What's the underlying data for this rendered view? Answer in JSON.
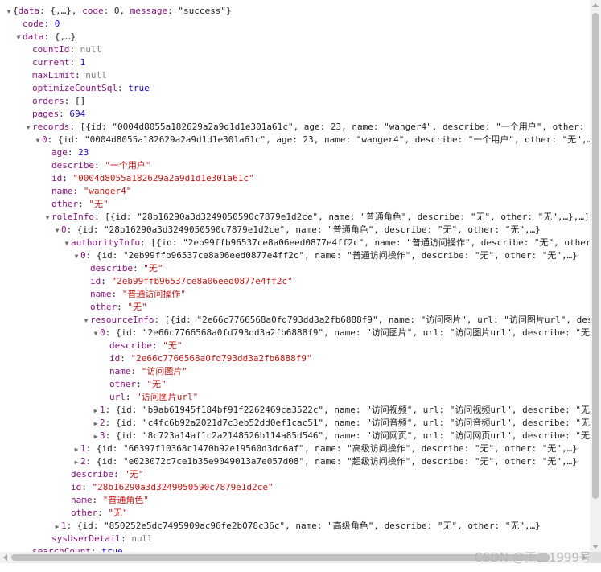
{
  "lines": [
    {
      "indent": 0,
      "arrow": "down",
      "segs": [
        [
          "plain",
          "{"
        ],
        [
          "key",
          "data"
        ],
        [
          "plain",
          ": {,…}, "
        ],
        [
          "key",
          "code"
        ],
        [
          "plain",
          ": 0, "
        ],
        [
          "key",
          "message"
        ],
        [
          "plain",
          ": \"success\"}"
        ]
      ]
    },
    {
      "indent": 1,
      "arrow": "",
      "segs": [
        [
          "key",
          "code"
        ],
        [
          "plain",
          ": "
        ],
        [
          "num",
          "0"
        ]
      ]
    },
    {
      "indent": 1,
      "arrow": "down",
      "segs": [
        [
          "key",
          "data"
        ],
        [
          "plain",
          ": {,…}"
        ]
      ]
    },
    {
      "indent": 2,
      "arrow": "",
      "segs": [
        [
          "key",
          "countId"
        ],
        [
          "plain",
          ": "
        ],
        [
          "nul",
          "null"
        ]
      ]
    },
    {
      "indent": 2,
      "arrow": "",
      "segs": [
        [
          "key",
          "current"
        ],
        [
          "plain",
          ": "
        ],
        [
          "num",
          "1"
        ]
      ]
    },
    {
      "indent": 2,
      "arrow": "",
      "segs": [
        [
          "key",
          "maxLimit"
        ],
        [
          "plain",
          ": "
        ],
        [
          "nul",
          "null"
        ]
      ]
    },
    {
      "indent": 2,
      "arrow": "",
      "segs": [
        [
          "key",
          "optimizeCountSql"
        ],
        [
          "plain",
          ": "
        ],
        [
          "kw",
          "true"
        ]
      ]
    },
    {
      "indent": 2,
      "arrow": "",
      "segs": [
        [
          "key",
          "orders"
        ],
        [
          "plain",
          ": []"
        ]
      ]
    },
    {
      "indent": 2,
      "arrow": "",
      "segs": [
        [
          "key",
          "pages"
        ],
        [
          "plain",
          ": "
        ],
        [
          "num",
          "694"
        ]
      ]
    },
    {
      "indent": 2,
      "arrow": "down",
      "segs": [
        [
          "key",
          "records"
        ],
        [
          "plain",
          ": [{id: \"0004d8055a182629a2a9d1d1e301a61c\", age: 23, name: \"wanger4\", describe: \"一个用户\", other: \"无\",…},…]"
        ]
      ]
    },
    {
      "indent": 3,
      "arrow": "down",
      "segs": [
        [
          "idx",
          "0"
        ],
        [
          "plain",
          ": {id: \"0004d8055a182629a2a9d1d1e301a61c\", age: 23, name: \"wanger4\", describe: \"一个用户\", other: \"无\",…}"
        ]
      ]
    },
    {
      "indent": 4,
      "arrow": "",
      "segs": [
        [
          "key",
          "age"
        ],
        [
          "plain",
          ": "
        ],
        [
          "num",
          "23"
        ]
      ]
    },
    {
      "indent": 4,
      "arrow": "",
      "segs": [
        [
          "key",
          "describe"
        ],
        [
          "plain",
          ": "
        ],
        [
          "str",
          "\"一个用户\""
        ]
      ]
    },
    {
      "indent": 4,
      "arrow": "",
      "segs": [
        [
          "key",
          "id"
        ],
        [
          "plain",
          ": "
        ],
        [
          "str",
          "\"0004d8055a182629a2a9d1d1e301a61c\""
        ]
      ]
    },
    {
      "indent": 4,
      "arrow": "",
      "segs": [
        [
          "key",
          "name"
        ],
        [
          "plain",
          ": "
        ],
        [
          "str",
          "\"wanger4\""
        ]
      ]
    },
    {
      "indent": 4,
      "arrow": "",
      "segs": [
        [
          "key",
          "other"
        ],
        [
          "plain",
          ": "
        ],
        [
          "str",
          "\"无\""
        ]
      ]
    },
    {
      "indent": 4,
      "arrow": "down",
      "segs": [
        [
          "key",
          "roleInfo"
        ],
        [
          "plain",
          ": [{id: \"28b16290a3d3249050590c7879e1d2ce\", name: \"普通角色\", describe: \"无\", other: \"无\",…},…]"
        ]
      ]
    },
    {
      "indent": 5,
      "arrow": "down",
      "segs": [
        [
          "idx",
          "0"
        ],
        [
          "plain",
          ": {id: \"28b16290a3d3249050590c7879e1d2ce\", name: \"普通角色\", describe: \"无\", other: \"无\",…}"
        ]
      ]
    },
    {
      "indent": 6,
      "arrow": "down",
      "segs": [
        [
          "key",
          "authorityInfo"
        ],
        [
          "plain",
          ": [{id: \"2eb99ffb96537ce8a06eed0877e4ff2c\", name: \"普通访问操作\", describe: \"无\", other: \"无\",…},…]"
        ]
      ]
    },
    {
      "indent": 7,
      "arrow": "down",
      "segs": [
        [
          "idx",
          "0"
        ],
        [
          "plain",
          ": {id: \"2eb99ffb96537ce8a06eed0877e4ff2c\", name: \"普通访问操作\", describe: \"无\", other: \"无\",…}"
        ]
      ]
    },
    {
      "indent": 8,
      "arrow": "",
      "segs": [
        [
          "key",
          "describe"
        ],
        [
          "plain",
          ": "
        ],
        [
          "str",
          "\"无\""
        ]
      ]
    },
    {
      "indent": 8,
      "arrow": "",
      "segs": [
        [
          "key",
          "id"
        ],
        [
          "plain",
          ": "
        ],
        [
          "str",
          "\"2eb99ffb96537ce8a06eed0877e4ff2c\""
        ]
      ]
    },
    {
      "indent": 8,
      "arrow": "",
      "segs": [
        [
          "key",
          "name"
        ],
        [
          "plain",
          ": "
        ],
        [
          "str",
          "\"普通访问操作\""
        ]
      ]
    },
    {
      "indent": 8,
      "arrow": "",
      "segs": [
        [
          "key",
          "other"
        ],
        [
          "plain",
          ": "
        ],
        [
          "str",
          "\"无\""
        ]
      ]
    },
    {
      "indent": 8,
      "arrow": "down",
      "segs": [
        [
          "key",
          "resourceInfo"
        ],
        [
          "plain",
          ": [{id: \"2e66c7766568a0fd793dd3a2fb6888f9\", name: \"访问图片\", url: \"访问图片url\", describe: \"无\",…},…]"
        ]
      ]
    },
    {
      "indent": 9,
      "arrow": "down",
      "segs": [
        [
          "idx",
          "0"
        ],
        [
          "plain",
          ": {id: \"2e66c7766568a0fd793dd3a2fb6888f9\", name: \"访问图片\", url: \"访问图片url\", describe: \"无\",…}"
        ]
      ]
    },
    {
      "indent": 10,
      "arrow": "",
      "segs": [
        [
          "key",
          "describe"
        ],
        [
          "plain",
          ": "
        ],
        [
          "str",
          "\"无\""
        ]
      ]
    },
    {
      "indent": 10,
      "arrow": "",
      "segs": [
        [
          "key",
          "id"
        ],
        [
          "plain",
          ": "
        ],
        [
          "str",
          "\"2e66c7766568a0fd793dd3a2fb6888f9\""
        ]
      ]
    },
    {
      "indent": 10,
      "arrow": "",
      "segs": [
        [
          "key",
          "name"
        ],
        [
          "plain",
          ": "
        ],
        [
          "str",
          "\"访问图片\""
        ]
      ]
    },
    {
      "indent": 10,
      "arrow": "",
      "segs": [
        [
          "key",
          "other"
        ],
        [
          "plain",
          ": "
        ],
        [
          "str",
          "\"无\""
        ]
      ]
    },
    {
      "indent": 10,
      "arrow": "",
      "segs": [
        [
          "key",
          "url"
        ],
        [
          "plain",
          ": "
        ],
        [
          "str",
          "\"访问图片url\""
        ]
      ]
    },
    {
      "indent": 9,
      "arrow": "right",
      "segs": [
        [
          "idx",
          "1"
        ],
        [
          "plain",
          ": {id: \"b9ab61945f184bf91f2262469ca3522c\", name: \"访问视频\", url: \"访问视频url\", describe: \"无\",…}"
        ]
      ]
    },
    {
      "indent": 9,
      "arrow": "right",
      "segs": [
        [
          "idx",
          "2"
        ],
        [
          "plain",
          ": {id: \"c4fc6b92a2021d7c3eb52dd0ef1cac51\", name: \"访问音频\", url: \"访问音频url\", describe: \"无\",…}"
        ]
      ]
    },
    {
      "indent": 9,
      "arrow": "right",
      "segs": [
        [
          "idx",
          "3"
        ],
        [
          "plain",
          ": {id: \"8c723a14af1c2a2148526b114a85d546\", name: \"访问网页\", url: \"访问网页url\", describe: \"无\",…}"
        ]
      ]
    },
    {
      "indent": 7,
      "arrow": "right",
      "segs": [
        [
          "idx",
          "1"
        ],
        [
          "plain",
          ": {id: \"66397f10368c1470b92e19560d3dc6af\", name: \"高级访问操作\", describe: \"无\", other: \"无\",…}"
        ]
      ]
    },
    {
      "indent": 7,
      "arrow": "right",
      "segs": [
        [
          "idx",
          "2"
        ],
        [
          "plain",
          ": {id: \"e023072c7ce1b35e9049013a7e057d08\", name: \"超级访问操作\", describe: \"无\", other: \"无\",…}"
        ]
      ]
    },
    {
      "indent": 6,
      "arrow": "",
      "segs": [
        [
          "key",
          "describe"
        ],
        [
          "plain",
          ": "
        ],
        [
          "str",
          "\"无\""
        ]
      ]
    },
    {
      "indent": 6,
      "arrow": "",
      "segs": [
        [
          "key",
          "id"
        ],
        [
          "plain",
          ": "
        ],
        [
          "str",
          "\"28b16290a3d3249050590c7879e1d2ce\""
        ]
      ]
    },
    {
      "indent": 6,
      "arrow": "",
      "segs": [
        [
          "key",
          "name"
        ],
        [
          "plain",
          ": "
        ],
        [
          "str",
          "\"普通角色\""
        ]
      ]
    },
    {
      "indent": 6,
      "arrow": "",
      "segs": [
        [
          "key",
          "other"
        ],
        [
          "plain",
          ": "
        ],
        [
          "str",
          "\"无\""
        ]
      ]
    },
    {
      "indent": 5,
      "arrow": "right",
      "segs": [
        [
          "idx",
          "1"
        ],
        [
          "plain",
          ": {id: \"850252e5dc7495909ac96fe2b078c36c\", name: \"高级角色\", describe: \"无\", other: \"无\",…}"
        ]
      ]
    },
    {
      "indent": 4,
      "arrow": "",
      "segs": [
        [
          "key",
          "sysUserDetail"
        ],
        [
          "plain",
          ": "
        ],
        [
          "nul",
          "null"
        ]
      ]
    },
    {
      "indent": 2,
      "arrow": "",
      "segs": [
        [
          "key",
          "searchCount"
        ],
        [
          "plain",
          ": "
        ],
        [
          "kw",
          "true"
        ]
      ]
    }
  ],
  "watermark": "CSDN @王二1999号"
}
